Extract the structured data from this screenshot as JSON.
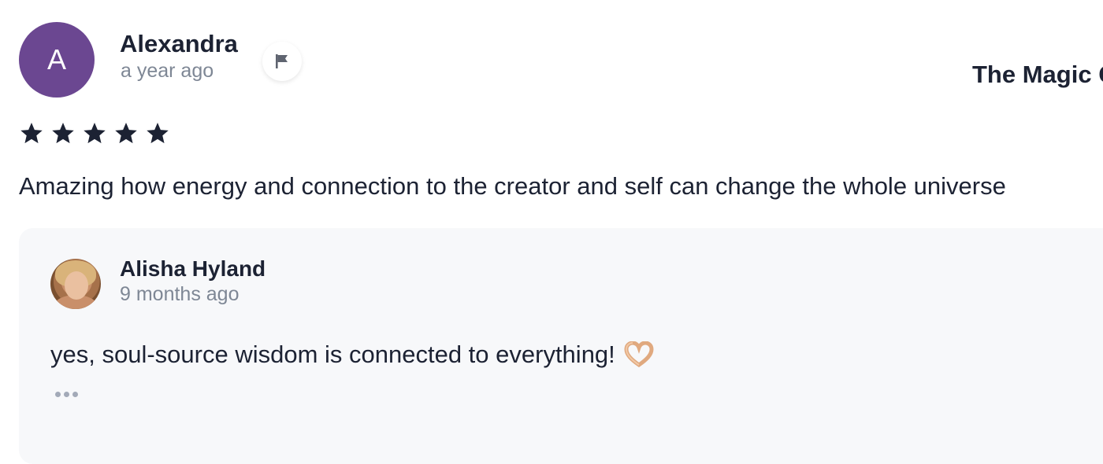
{
  "review": {
    "avatar_letter": "A",
    "author": "Alexandra",
    "time": "a year ago",
    "rating": 5,
    "text": "Amazing how energy and connection to the creator and self can change the whole universe",
    "flag_icon": "flag-icon",
    "star_color": "#1c2233",
    "avatar_color": "#6b4791"
  },
  "course": {
    "title": "The Magic C"
  },
  "reply": {
    "author": "Alisha Hyland",
    "time": "9 months ago",
    "text": "yes, soul-source wisdom is connected to everything!",
    "emoji_icon": "heart-hands-icon",
    "more_icon": "ellipsis-icon"
  }
}
